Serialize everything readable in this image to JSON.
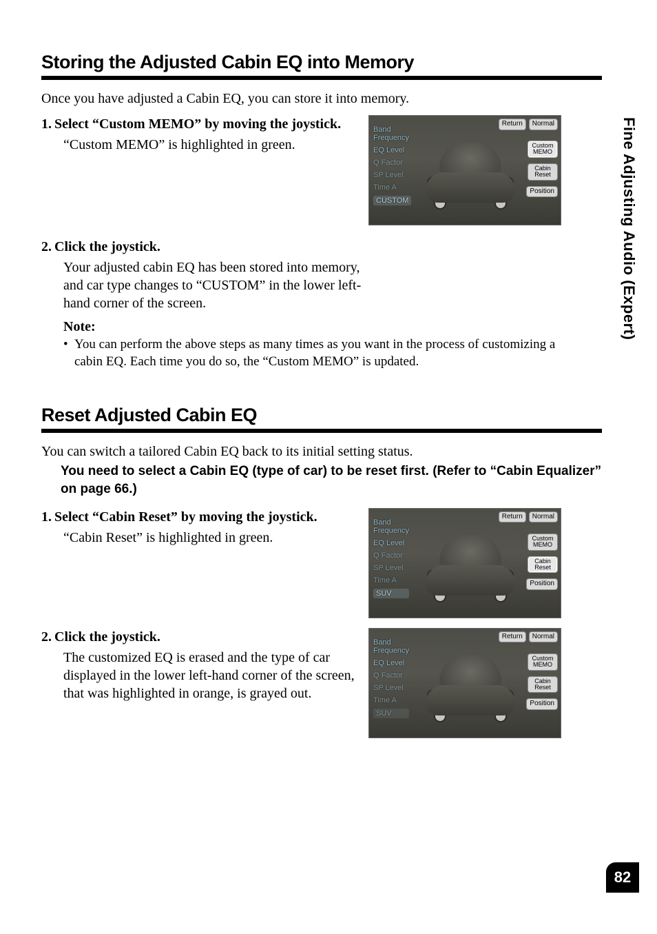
{
  "sideTab": "Fine Adjusting Audio (Expert)",
  "pageNumber": "82",
  "section1": {
    "title": "Storing the Adjusted Cabin EQ into Memory",
    "intro": "Once you have adjusted a Cabin EQ, you can store it into memory.",
    "steps": [
      {
        "num": "1.",
        "head": "Select “Custom MEMO” by moving the joystick.",
        "body": "“Custom MEMO” is highlighted in green."
      },
      {
        "num": "2.",
        "head": "Click the joystick.",
        "body": "Your adjusted cabin EQ has been stored into memory, and car type changes to “CUSTOM” in the lower left-hand corner of the screen."
      }
    ],
    "noteLabel": "Note:",
    "noteBullet": "•",
    "noteBody": "You can perform the above steps as many times as you want in the process of customizing a cabin EQ. Each time you do so, the “Custom MEMO” is updated."
  },
  "section2": {
    "title": "Reset Adjusted Cabin EQ",
    "intro": "You can switch a tailored Cabin EQ back to its initial setting status.",
    "subIntro": "You need to select a Cabin EQ (type of car) to be reset first. (Refer to “Cabin Equalizer” on page 66.)",
    "steps": [
      {
        "num": "1.",
        "head": "Select “Cabin Reset” by moving the joystick.",
        "body": "“Cabin Reset” is highlighted in green."
      },
      {
        "num": "2.",
        "head": "Click the joystick.",
        "body": "The customized EQ is erased and the type of car displayed in the lower left-hand corner of the screen, that was highlighted in orange, is grayed out."
      }
    ]
  },
  "ui": {
    "leftMenu": {
      "bandFreq": "Band\nFrequency",
      "eqLevel": "EQ Level",
      "qFactor": "Q Factor",
      "spLevel": "SP Level",
      "timeA": "Time A"
    },
    "bottomTag": {
      "custom": "CUSTOM",
      "suv": "SUV"
    },
    "right": {
      "return": "Return",
      "normal": "Normal",
      "customMemo": "Custom\nMEMO",
      "cabinReset": "Cabin\nReset",
      "position": "Position"
    }
  }
}
